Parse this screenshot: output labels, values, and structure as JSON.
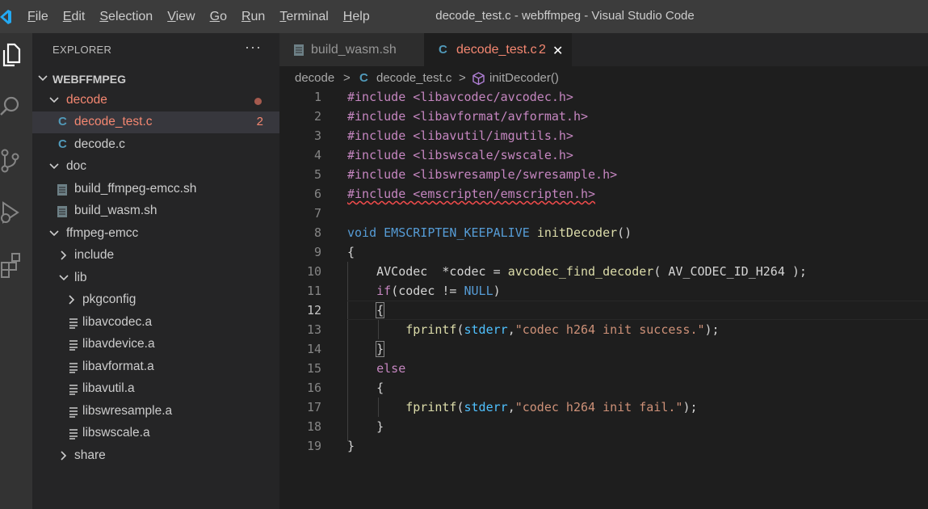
{
  "window": {
    "title": "decode_test.c - webffmpeg - Visual Studio Code"
  },
  "menu": [
    {
      "first": "F",
      "rest": "ile"
    },
    {
      "first": "E",
      "rest": "dit"
    },
    {
      "first": "S",
      "rest": "election"
    },
    {
      "first": "V",
      "rest": "iew"
    },
    {
      "first": "G",
      "rest": "o"
    },
    {
      "first": "R",
      "rest": "un"
    },
    {
      "first": "T",
      "rest": "erminal"
    },
    {
      "first": "H",
      "rest": "elp"
    }
  ],
  "activitybar": {
    "icons": [
      "files-icon",
      "search-icon",
      "source-control-icon",
      "run-debug-icon",
      "extensions-icon"
    ]
  },
  "sidebar": {
    "header": "EXPLORER",
    "more": "···",
    "root": "WEBFFMPEG",
    "items": [
      {
        "label": "decode",
        "type": "folder-open",
        "status": "modified"
      },
      {
        "label": "decode_test.c",
        "type": "c",
        "badge": "2"
      },
      {
        "label": "decode.c",
        "type": "c"
      },
      {
        "label": "doc",
        "type": "folder-open"
      },
      {
        "label": "build_ffmpeg-emcc.sh",
        "type": "sh"
      },
      {
        "label": "build_wasm.sh",
        "type": "sh"
      },
      {
        "label": "ffmpeg-emcc",
        "type": "folder-open"
      },
      {
        "label": "include",
        "type": "folder-closed"
      },
      {
        "label": "lib",
        "type": "folder-open"
      },
      {
        "label": "pkgconfig",
        "type": "folder-closed"
      },
      {
        "label": "libavcodec.a",
        "type": "lib"
      },
      {
        "label": "libavdevice.a",
        "type": "lib"
      },
      {
        "label": "libavformat.a",
        "type": "lib"
      },
      {
        "label": "libavutil.a",
        "type": "lib"
      },
      {
        "label": "libswresample.a",
        "type": "lib"
      },
      {
        "label": "libswscale.a",
        "type": "lib"
      },
      {
        "label": "share",
        "type": "folder-closed"
      }
    ]
  },
  "tabs": [
    {
      "label": "build_wasm.sh",
      "icon": "sh-file-icon"
    },
    {
      "label": "decode_test.c",
      "icon_text": "C",
      "badge": "2",
      "close": "✕"
    }
  ],
  "breadcrumb": {
    "folder": "decode",
    "sep": ">",
    "file_icon": "C",
    "file": "decode_test.c",
    "symbol": "initDecoder()"
  },
  "code": {
    "active_line": 12,
    "lines": [
      "#include <libavcodec/avcodec.h>",
      "#include <libavformat/avformat.h>",
      "#include <libavutil/imgutils.h>",
      "#include <libswscale/swscale.h>",
      "#include <libswresample/swresample.h>",
      "#include <emscripten/emscripten.h>",
      "",
      "void EMSCRIPTEN_KEEPALIVE initDecoder()",
      "{",
      "    AVCodec  *codec = avcodec_find_decoder( AV_CODEC_ID_H264 );",
      "    if(codec != NULL)",
      "    {",
      "        fprintf(stderr,\"codec h264 init success.\");",
      "    }",
      "    else",
      "    {",
      "        fprintf(stderr,\"codec h264 init fail.\");",
      "    }",
      "}"
    ]
  },
  "colors": {
    "error": "#f48771",
    "c_icon": "#519aba",
    "keyword": "#569cd6",
    "string": "#ce9178",
    "preprocessor": "#c586c0",
    "function": "#dcdcaa"
  }
}
